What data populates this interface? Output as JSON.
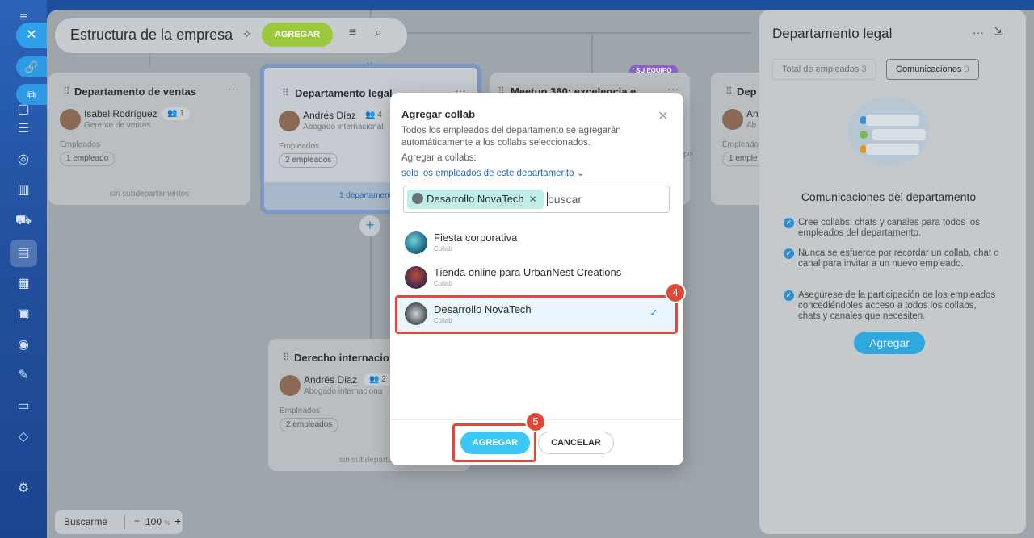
{
  "header": {
    "title": "Estructura de la empresa",
    "add_label": "AGREGAR"
  },
  "departments": [
    {
      "title": "Departamento de ventas",
      "person": "Isabel Rodríguez",
      "count": "1",
      "role": "Gerente de ventas",
      "employees_label": "Empleados",
      "employees": "1 empleado",
      "sub": "sin subdepartamentos"
    },
    {
      "title": "Departamento legal",
      "person": "Andrés Díaz",
      "count": "4",
      "role": "Abogado internacional",
      "employees_label": "Empleados",
      "employees": "2 empleados",
      "sub": "1 departamento"
    },
    {
      "title": "Meetup 360: excelencia e…",
      "role": "po"
    },
    {
      "title": "Dep",
      "person": "An",
      "role": "Ab",
      "employees_label": "Empleado",
      "employees": "1 emple"
    },
    {
      "title": "Derecho internacio",
      "person": "Andrés Díaz",
      "count": "2",
      "role": "Abogado internaciona",
      "employees_label": "Empleados",
      "employees": "2 empleados",
      "sub": "sin subdepartam"
    }
  ],
  "su_equipo_label": "SU EQUIPO",
  "zoom": {
    "find_me": "Buscarme",
    "minus": "−",
    "value": "100",
    "unit": "%",
    "plus": "+"
  },
  "right_panel": {
    "title": "Departamento legal",
    "tabs": [
      {
        "label": "Total de empleados",
        "count": "3"
      },
      {
        "label": "Comunicaciones",
        "count": "0"
      }
    ],
    "heading": "Comunicaciones del departamento",
    "items": [
      "Cree collabs, chats y canales para todos los empleados del departamento.",
      "Nunca se esfuerce por recordar un collab, chat o canal para invitar a un nuevo empleado.",
      "Asegúrese de la participación de los empleados concediéndoles acceso a todos los collabs, chats y canales que necesiten."
    ],
    "add_label": "Agregar"
  },
  "modal": {
    "title": "Agregar collab",
    "description": "Todos los empleados del departamento se agregarán automáticamente a los collabs seleccionados.",
    "add_to_label": "Agregar a collabs:",
    "scope_link": "solo los empleados de este departamento",
    "chip_label": "Desarrollo NovaTech",
    "search_placeholder": "buscar",
    "options": [
      {
        "name": "Fiesta corporativa",
        "type": "Collab",
        "selected": false
      },
      {
        "name": "Tienda online para UrbanNest Creations",
        "type": "Collab",
        "selected": false
      },
      {
        "name": "Desarrollo NovaTech",
        "type": "Collab",
        "selected": true
      }
    ],
    "confirm_label": "AGREGAR",
    "cancel_label": "CANCELAR"
  },
  "steps": {
    "select": "4",
    "confirm": "5"
  },
  "colors": {
    "accent": "#3bc8f5",
    "highlight": "#e0493a",
    "add_green": "#9cc93b",
    "su_equipo": "#8a63c6"
  }
}
